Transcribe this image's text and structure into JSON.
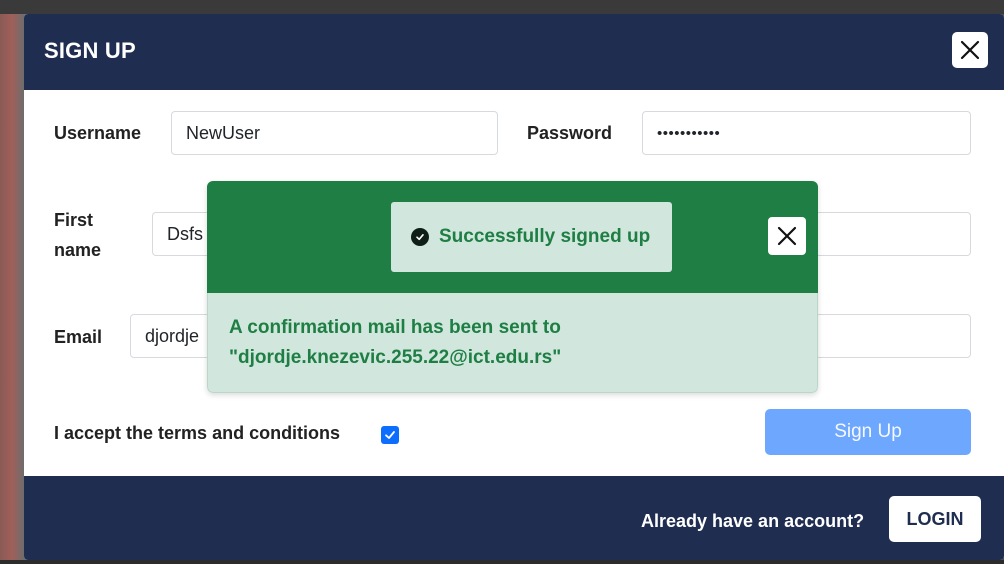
{
  "modal": {
    "title": "SIGN UP",
    "close_icon": "close-icon"
  },
  "form": {
    "username_label": "Username",
    "username_value": "NewUser",
    "password_label": "Password",
    "password_value": "•••••••••••",
    "first_name_label_line1": "First",
    "first_name_label_line2": "name",
    "first_name_value": "Dsfs",
    "email_label": "Email",
    "email_value": "djordje",
    "terms_label": "I accept the terms and conditions",
    "terms_checked": true,
    "signup_label": "Sign Up"
  },
  "footer": {
    "prompt": "Already have an account?",
    "login_label": "LOGIN"
  },
  "toast": {
    "title": "Successfully signed up",
    "message_line1": "A confirmation mail has been sent to",
    "message_line2": "\"djordje.knezevic.255.22@ict.edu.rs\"",
    "icon": "check-circle-icon"
  },
  "colors": {
    "header": "#1f2d51",
    "success": "#1e7e44",
    "success_light": "#d1e7dd",
    "primary_light": "#6ea8fe",
    "checkbox": "#0d6efd"
  }
}
